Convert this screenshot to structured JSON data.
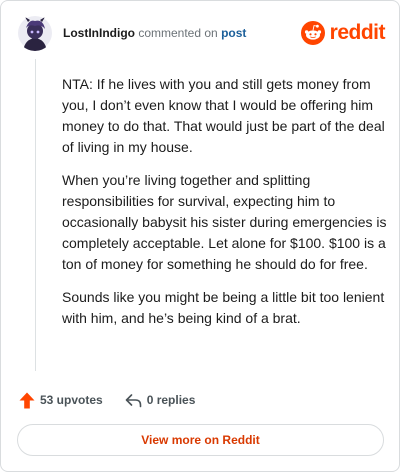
{
  "header": {
    "username": "LostInIndigo",
    "commented_on": "commented on",
    "post_link": "post",
    "brand": "reddit"
  },
  "comment": {
    "paragraphs": [
      "NTA: If he lives with you and still gets money from you, I don’t even know that I would be offering him money to do that. That would just be part of the deal of living in my house.",
      "When you’re living together and splitting responsibilities for survival, expecting him to occasionally babysit his sister during emergencies is completely acceptable. Let alone for $100. $100 is a ton of money for something he should do for free.",
      "Sounds like you might be being a little bit too lenient with him, and he’s being kind of a brat."
    ]
  },
  "actions": {
    "upvotes": "53 upvotes",
    "replies": "0 replies"
  },
  "footer": {
    "view_more": "View more on Reddit"
  },
  "colors": {
    "brand": "#ff4500",
    "link": "#1b5f9a",
    "view_more": "#d93900"
  },
  "icons": {
    "avatar": "avatar",
    "logo": "reddit-snoo-icon",
    "upvote": "upvote-arrow-icon",
    "reply": "reply-arrow-icon"
  }
}
